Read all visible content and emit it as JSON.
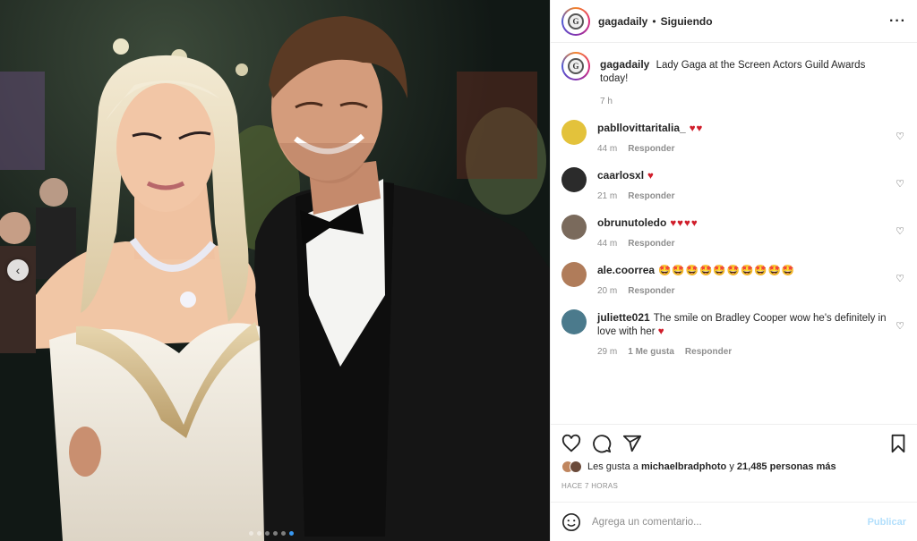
{
  "post": {
    "username": "gagadaily",
    "follow_status": "Siguiendo",
    "more_icon": "ellipsis-icon"
  },
  "caption": {
    "username": "gagadaily",
    "text": "Lady Gaga at the Screen Actors Guild Awards today!",
    "time": "7 h"
  },
  "comments": [
    {
      "username": "pabllovittaritalia_",
      "text": "",
      "hearts": "♥♥",
      "time": "44 m",
      "reply": "Responder",
      "avatar_color": "#e3c23b"
    },
    {
      "username": "caarlosxl",
      "text": "",
      "hearts": "♥",
      "time": "21 m",
      "reply": "Responder",
      "avatar_color": "#2b2b2b"
    },
    {
      "username": "obrunutoledo",
      "text": "",
      "hearts": "♥♥♥♥",
      "time": "44 m",
      "reply": "Responder",
      "avatar_color": "#7a6a5c"
    },
    {
      "username": "ale.coorrea",
      "text": "",
      "emojis": "🤩🤩🤩🤩🤩🤩🤩🤩🤩🤩",
      "time": "20 m",
      "reply": "Responder",
      "avatar_color": "#b07c5a"
    },
    {
      "username": "juliette021",
      "text": "The smile on Bradley Cooper wow he's definitely in love with her",
      "hearts": "♥",
      "time": "29 m",
      "likes": "1 Me gusta",
      "reply": "Responder",
      "avatar_color": "#4b7a8c"
    }
  ],
  "likes": {
    "prefix": "Les gusta a",
    "user": "michaelbradphoto",
    "connector": "y",
    "others": "21,485 personas más"
  },
  "time_ago": "HACE 7 HORAS",
  "add_comment": {
    "placeholder": "Agrega un comentario...",
    "publish": "Publicar"
  },
  "carousel": {
    "slides": 6,
    "active": 6
  },
  "colors": {
    "accent": "#3897f0",
    "heart": "#d01d2a",
    "publish_disabled": "#b2dffc"
  }
}
